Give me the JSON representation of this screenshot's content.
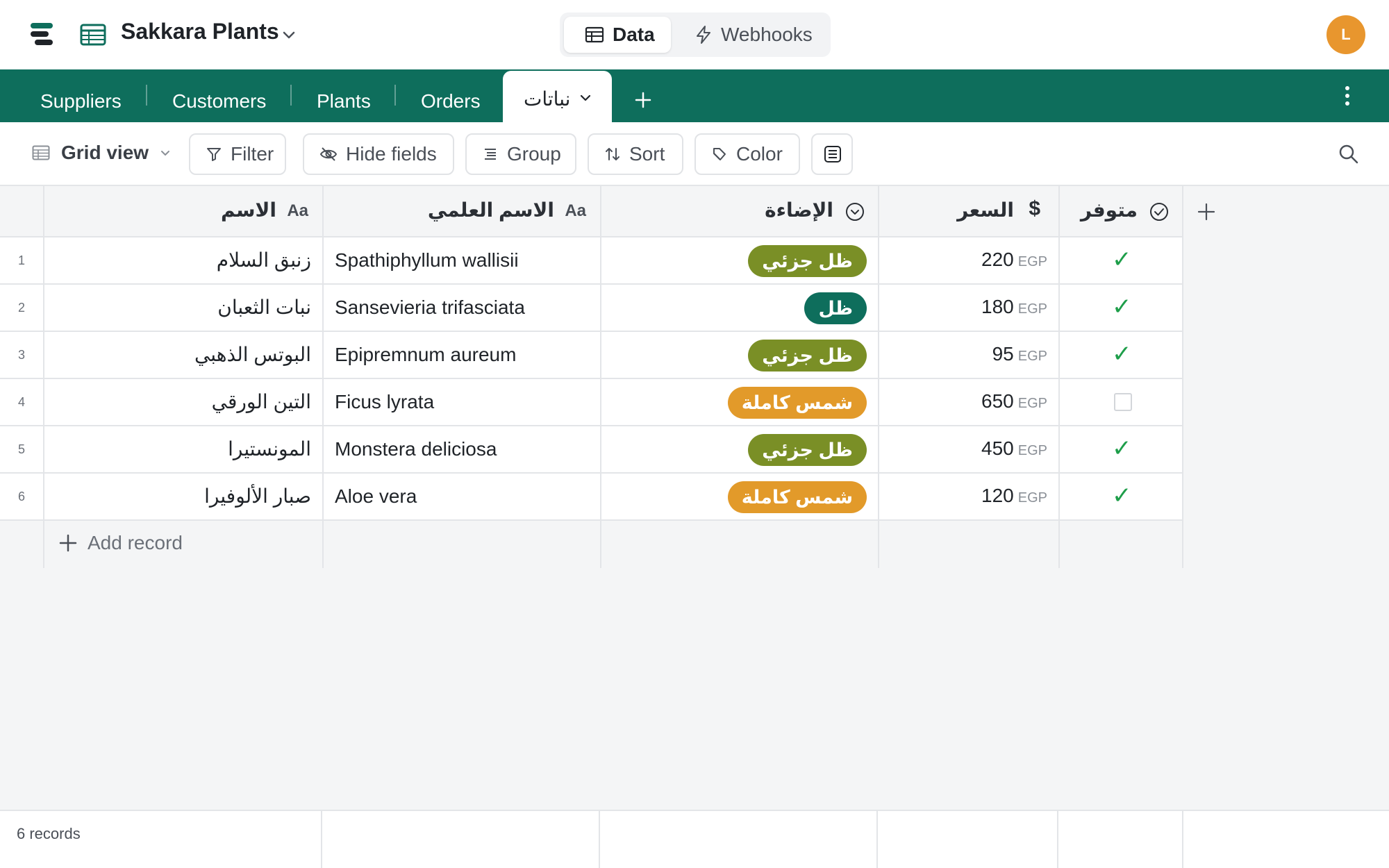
{
  "header": {
    "base_name": "Sakkara Plants",
    "nav": {
      "data_label": "Data",
      "webhooks_label": "Webhooks"
    },
    "avatar_initial": "L"
  },
  "tabs": {
    "items": [
      "Suppliers",
      "Customers",
      "Plants",
      "Orders"
    ],
    "active": "نباتات"
  },
  "toolbar": {
    "view_label": "Grid view",
    "filter_label": "Filter",
    "hide_fields_label": "Hide fields",
    "group_label": "Group",
    "sort_label": "Sort",
    "color_label": "Color"
  },
  "table": {
    "columns": {
      "name": {
        "label": "الاسم",
        "type_icon": "Aa"
      },
      "scientific": {
        "label": "الاسم العلمي",
        "type_icon": "Aa"
      },
      "light": {
        "label": "الإضاءة",
        "type_icon": "single-select-icon"
      },
      "price": {
        "label": "السعر",
        "type_icon": "$"
      },
      "available": {
        "label": "متوفر",
        "type_icon": "checkbox-icon"
      }
    },
    "currency": "EGP",
    "rows": [
      {
        "num": "1",
        "name": "زنبق السلام",
        "scientific": "Spathiphyllum wallisii",
        "light": "ظل جزئي",
        "price": "220",
        "available": true
      },
      {
        "num": "2",
        "name": "نبات الثعبان",
        "scientific": "Sansevieria trifasciata",
        "light": "ظل",
        "price": "180",
        "available": true
      },
      {
        "num": "3",
        "name": "البوتس الذهبي",
        "scientific": "Epipremnum aureum",
        "light": "ظل جزئي",
        "price": "95",
        "available": true
      },
      {
        "num": "4",
        "name": "التين الورقي",
        "scientific": "Ficus lyrata",
        "light": "شمس كاملة",
        "price": "650",
        "available": false
      },
      {
        "num": "5",
        "name": "المونستيرا",
        "scientific": "Monstera deliciosa",
        "light": "ظل جزئي",
        "price": "450",
        "available": true
      },
      {
        "num": "6",
        "name": "صبار الألوفيرا",
        "scientific": "Aloe vera",
        "light": "شمس كاملة",
        "price": "120",
        "available": true
      }
    ],
    "light_colors": {
      "ظل جزئي": "#7a8f26",
      "ظل": "#0e6e5c",
      "شمس كاملة": "#e29a2a"
    },
    "add_record_label": "Add record"
  },
  "footer": {
    "record_count": "6 records"
  },
  "colors": {
    "brand": "#0e6e5c",
    "avatar": "#e8962e",
    "check": "#1e9e4a"
  }
}
